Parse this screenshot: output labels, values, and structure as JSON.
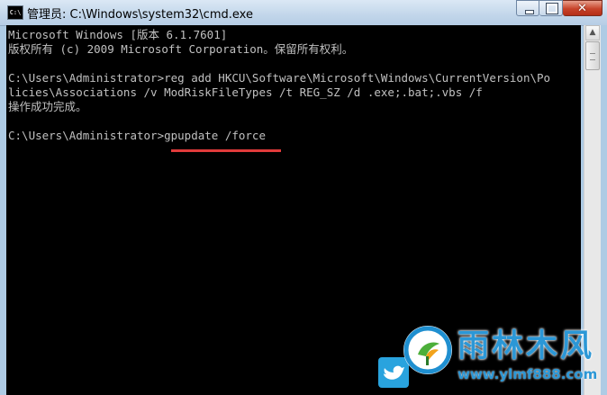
{
  "window": {
    "icon_text": "C:\\",
    "title": "管理员: C:\\Windows\\system32\\cmd.exe",
    "close_glyph": "✕"
  },
  "console": {
    "lines": [
      "Microsoft Windows [版本 6.1.7601]",
      "版权所有 (c) 2009 Microsoft Corporation。保留所有权利。",
      "",
      "C:\\Users\\Administrator>reg add HKCU\\Software\\Microsoft\\Windows\\CurrentVersion\\Po",
      "licies\\Associations /v ModRiskFileTypes /t REG_SZ /d .exe;.bat;.vbs /f",
      "操作成功完成。",
      "",
      "C:\\Users\\Administrator>gpupdate /force"
    ],
    "highlight_color": "#e13b3b"
  },
  "scrollbar": {
    "up_arrow": "▲"
  },
  "watermark": {
    "text": "雨林木风",
    "url": "www.ylmf888.com",
    "color": "#2b97d6"
  }
}
